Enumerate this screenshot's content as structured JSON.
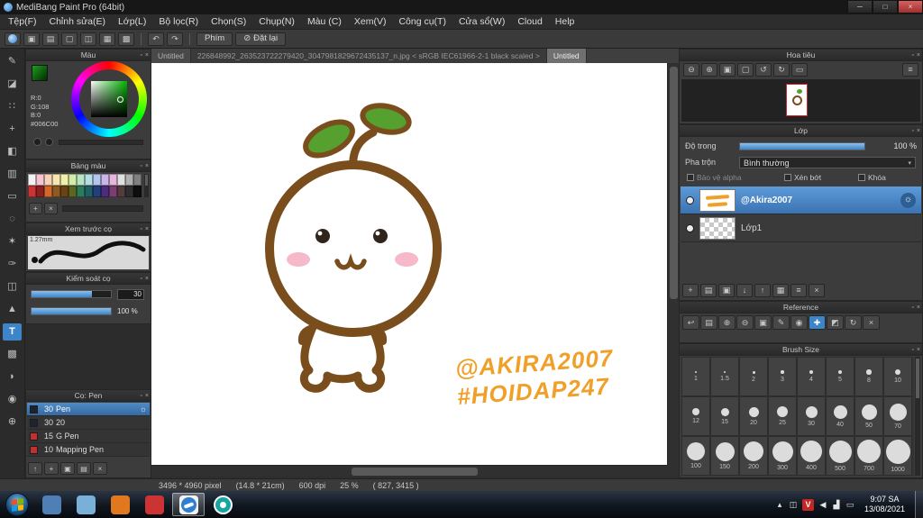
{
  "ui": {
    "popout_glyph": "▫",
    "close_glyph": "×",
    "caret_glyph": "▾",
    "gear_glyph": "☼",
    "slash_glyph": "⊘"
  },
  "window": {
    "title": "MediBang Paint Pro (64bit)",
    "controls": [
      {
        "name": "minimize-button",
        "glyph": "─"
      },
      {
        "name": "maximize-button",
        "glyph": "□"
      },
      {
        "name": "close-button",
        "glyph": "×",
        "close": true
      }
    ]
  },
  "menu": {
    "items": [
      {
        "label": "Tệp(F)"
      },
      {
        "label": "Chỉnh sửa(E)"
      },
      {
        "label": "Lớp(L)"
      },
      {
        "label": "Bộ lọc(R)"
      },
      {
        "label": "Chọn(S)"
      },
      {
        "label": "Chụp(N)"
      },
      {
        "label": "Màu (C)"
      },
      {
        "label": "Xem(V)"
      },
      {
        "label": "Công cụ(T)"
      },
      {
        "label": "Cửa sổ(W)"
      },
      {
        "label": "Cloud"
      },
      {
        "label": "Help"
      }
    ]
  },
  "toolbar": {
    "icons": [
      {
        "name": "save-icon",
        "glyph": "▣"
      },
      {
        "name": "export-icon",
        "glyph": "▤"
      },
      {
        "name": "comment-icon",
        "glyph": "▢"
      },
      {
        "name": "display-icon",
        "glyph": "◫"
      },
      {
        "name": "grid-icon",
        "glyph": "▦"
      },
      {
        "name": "materials-icon",
        "glyph": "▩"
      }
    ],
    "history": [
      {
        "name": "undo-icon",
        "glyph": "↶"
      },
      {
        "name": "redo-icon",
        "glyph": "↷"
      }
    ],
    "phim_label": "Phím",
    "reset_label": "Đặt lại"
  },
  "tools": [
    {
      "name": "brush-tool",
      "glyph": "✎"
    },
    {
      "name": "eraser-tool",
      "glyph": "◪"
    },
    {
      "name": "dot-tool",
      "glyph": "∷"
    },
    {
      "name": "move-tool",
      "glyph": "+"
    },
    {
      "name": "fill-tool",
      "glyph": "◧"
    },
    {
      "name": "gradient-tool",
      "glyph": "▥"
    },
    {
      "name": "select-tool",
      "glyph": "▭"
    },
    {
      "name": "lasso-tool",
      "glyph": "◌"
    },
    {
      "name": "magic-wand-tool",
      "glyph": "✶"
    },
    {
      "name": "select-pen-tool",
      "glyph": "✑"
    },
    {
      "name": "select-eraser-tool",
      "glyph": "◫"
    },
    {
      "name": "operation-tool",
      "glyph": "▲"
    },
    {
      "name": "text-tool",
      "glyph": "T",
      "active": true
    },
    {
      "name": "divide-tool",
      "glyph": "▩"
    },
    {
      "name": "eyedropper-tool",
      "glyph": "◗"
    },
    {
      "name": "hand-tool",
      "glyph": "◉"
    },
    {
      "name": "zoom-tool",
      "glyph": "⊕"
    }
  ],
  "color_panel": {
    "title": "Màu",
    "r": "R:0",
    "g": "G:108",
    "b": "B:0",
    "hex": "#006C00"
  },
  "palette_panel": {
    "title": "Bảng màu",
    "colors": [
      {
        "c": "#f2f2f2"
      },
      {
        "c": "#f6c3d0"
      },
      {
        "c": "#f6d3b8"
      },
      {
        "c": "#f6e6b0"
      },
      {
        "c": "#f0f0a8"
      },
      {
        "c": "#d2ecaa"
      },
      {
        "c": "#b8e4c4"
      },
      {
        "c": "#b2dee4"
      },
      {
        "c": "#b4c6ec"
      },
      {
        "c": "#c8b6e8"
      },
      {
        "c": "#e6b6dc"
      },
      {
        "c": "#e0e0e0"
      },
      {
        "c": "#b0b0b0"
      },
      {
        "c": "#808080"
      },
      {
        "c": "#cc3333"
      },
      {
        "c": "#8c1f1f"
      },
      {
        "c": "#d4682a"
      },
      {
        "c": "#8c5a22"
      },
      {
        "c": "#6a4216"
      },
      {
        "c": "#5c6622"
      },
      {
        "c": "#2c7c5c"
      },
      {
        "c": "#206066"
      },
      {
        "c": "#22407c"
      },
      {
        "c": "#4c2c7c"
      },
      {
        "c": "#7c3e70"
      },
      {
        "c": "#553c3c"
      },
      {
        "c": "#2e2e2e"
      },
      {
        "c": "#0e0e0e"
      }
    ],
    "footer": [
      {
        "name": "palette-add-icon",
        "glyph": "+"
      },
      {
        "name": "palette-delete-icon",
        "glyph": "×"
      }
    ]
  },
  "preview_panel": {
    "title": "Xem trước cọ",
    "size_label": "1.27mm"
  },
  "control_panel": {
    "title": "Kiểm soát cọ",
    "size_value": "30",
    "opacity_value": "100 %"
  },
  "brush_panel": {
    "title": "Cọ: Pen",
    "brushes": [
      {
        "size": "30",
        "name": "Pen",
        "chip": "#1b2430",
        "selected": true
      },
      {
        "size": "30",
        "name": "20",
        "chip": "#1b2430"
      },
      {
        "size": "15",
        "name": "G Pen",
        "chip": "#c23030"
      },
      {
        "size": "10",
        "name": "Mapping Pen",
        "chip": "#c23030"
      }
    ],
    "footer": [
      {
        "name": "brush-up-icon",
        "glyph": "↑"
      },
      {
        "name": "add-brush-icon",
        "glyph": "+"
      },
      {
        "name": "duplicate-brush-icon",
        "glyph": "▣"
      },
      {
        "name": "brush-folder-icon",
        "glyph": "▤"
      },
      {
        "name": "delete-brush-icon",
        "glyph": "×"
      }
    ]
  },
  "tabs": [
    {
      "label": "Untitled"
    },
    {
      "label": "226848992_263523722279420_3047981829672435137_n.jpg < sRGB IEC61966-2-1 black scaled >",
      "dim": true
    },
    {
      "label": "Untitled",
      "active": true
    }
  ],
  "canvas": {
    "watermark_line1": "@AKIRA2007",
    "watermark_line2": "#HOIDAP247"
  },
  "navigator_panel": {
    "title": "Hoa tiêu",
    "buttons": [
      {
        "name": "zoom-out-icon",
        "glyph": "⊖"
      },
      {
        "name": "zoom-in-icon",
        "glyph": "⊕"
      },
      {
        "name": "fit-window-icon",
        "glyph": "▣"
      },
      {
        "name": "actual-pixels-icon",
        "glyph": "▢"
      },
      {
        "name": "rotate-ccw-icon",
        "glyph": "↺"
      },
      {
        "name": "rotate-cw-icon",
        "glyph": "↻"
      },
      {
        "name": "reset-rotation-icon",
        "glyph": "▭"
      }
    ],
    "menu_glyph": "≡"
  },
  "layer_panel": {
    "title": "Lớp",
    "opacity_label": "Độ trong",
    "opacity_value": "100 %",
    "blend_label": "Pha trộn",
    "blend_value": "Bình thường",
    "alpha_label": "Bảo vệ alpha",
    "clip_label": "Xén bớt",
    "lock_label": "Khóa",
    "layers": [
      {
        "name": "@Akira2007",
        "selected": true,
        "art": true
      },
      {
        "name": "Lớp1",
        "checker": true
      }
    ],
    "footer": [
      {
        "name": "add-layer-icon",
        "glyph": "+"
      },
      {
        "name": "add-folder-icon",
        "glyph": "▤"
      },
      {
        "name": "duplicate-layer-icon",
        "glyph": "▣"
      },
      {
        "name": "merge-down-icon",
        "glyph": "↓"
      },
      {
        "name": "move-layer-up-icon",
        "glyph": "↑"
      },
      {
        "name": "layer-folder-icon",
        "glyph": "▦"
      },
      {
        "name": "layer-settings-icon",
        "glyph": "≡"
      },
      {
        "name": "delete-layer-icon",
        "glyph": "×"
      }
    ]
  },
  "reference_panel": {
    "title": "Reference",
    "buttons": [
      {
        "name": "ref-undo-icon",
        "glyph": "↩"
      },
      {
        "name": "ref-open-icon",
        "glyph": "▤"
      },
      {
        "name": "ref-zoom-in-icon",
        "glyph": "⊕"
      },
      {
        "name": "ref-zoom-out-icon",
        "glyph": "⊖"
      },
      {
        "name": "ref-fit-icon",
        "glyph": "▣"
      },
      {
        "name": "ref-pencil-icon",
        "glyph": "✎"
      },
      {
        "name": "ref-eyedropper-icon",
        "glyph": "◉"
      },
      {
        "name": "ref-hand-icon",
        "glyph": "✚",
        "active": true
      },
      {
        "name": "ref-lock-icon",
        "glyph": "◩"
      },
      {
        "name": "ref-rotate-icon",
        "glyph": "↻"
      },
      {
        "name": "ref-close-icon",
        "glyph": "×"
      }
    ]
  },
  "brush_size_panel": {
    "title": "Brush Size",
    "sizes": [
      {
        "label": "1",
        "d": 2
      },
      {
        "label": "1.5",
        "d": 2.5
      },
      {
        "label": "2",
        "d": 3
      },
      {
        "label": "3",
        "d": 3.5
      },
      {
        "label": "4",
        "d": 4
      },
      {
        "label": "5",
        "d": 4.5
      },
      {
        "label": "8",
        "d": 5.5
      },
      {
        "label": "10",
        "d": 6.5
      },
      {
        "label": "12",
        "d": 8
      },
      {
        "label": "15",
        "d": 9
      },
      {
        "label": "20",
        "d": 11
      },
      {
        "label": "25",
        "d": 12
      },
      {
        "label": "30",
        "d": 13
      },
      {
        "label": "40",
        "d": 15
      },
      {
        "label": "50",
        "d": 17
      },
      {
        "label": "70",
        "d": 19
      },
      {
        "label": "100",
        "d": 20
      },
      {
        "label": "150",
        "d": 21
      },
      {
        "label": "200",
        "d": 22
      },
      {
        "label": "300",
        "d": 23
      },
      {
        "label": "400",
        "d": 24
      },
      {
        "label": "500",
        "d": 25
      },
      {
        "label": "700",
        "d": 26
      },
      {
        "label": "1000",
        "d": 27
      }
    ]
  },
  "status_bar": {
    "size_px": "3496 * 4960 pixel",
    "size_cm": "(14.8 * 21cm)",
    "dpi": "600 dpi",
    "zoom": "25 %",
    "coords": "( 827, 3415 )"
  },
  "taskbar": {
    "apps": [
      {
        "name": "taskbar-app-1",
        "color": "#4f7fb5"
      },
      {
        "name": "taskbar-app-2",
        "color": "#7ab0d8"
      },
      {
        "name": "taskbar-app-3",
        "color": "#e07820"
      },
      {
        "name": "taskbar-app-4",
        "color": "#cc3333"
      },
      {
        "name": "taskbar-app-medibang",
        "medibang": true,
        "active": true
      },
      {
        "name": "taskbar-app-coccoc",
        "coccoc": true
      }
    ],
    "tray": [
      {
        "name": "tray-expand-icon",
        "glyph": "▴"
      },
      {
        "name": "tray-display-icon",
        "glyph": "◫"
      },
      {
        "name": "tray-unikey-icon",
        "glyph": "V",
        "red": true
      },
      {
        "name": "tray-volume-icon",
        "glyph": "◀"
      },
      {
        "name": "tray-network-icon",
        "glyph": "▟"
      },
      {
        "name": "tray-action-icon",
        "glyph": "▭"
      }
    ],
    "time": "9:07 SA",
    "date": "13/08/2021"
  },
  "colors": {
    "accent_blue": "#3d84c8",
    "selection_blue": "#3b73b3",
    "outline_brown": "#7a4d1c",
    "leaf_green": "#55a02e",
    "blush_pink": "#f6b9ca",
    "watermark_orange": "#f0a028",
    "picked_green": "#006C00",
    "medibang_blue": "#2f7fd0",
    "coccoc_teal": "#18a5a0"
  }
}
